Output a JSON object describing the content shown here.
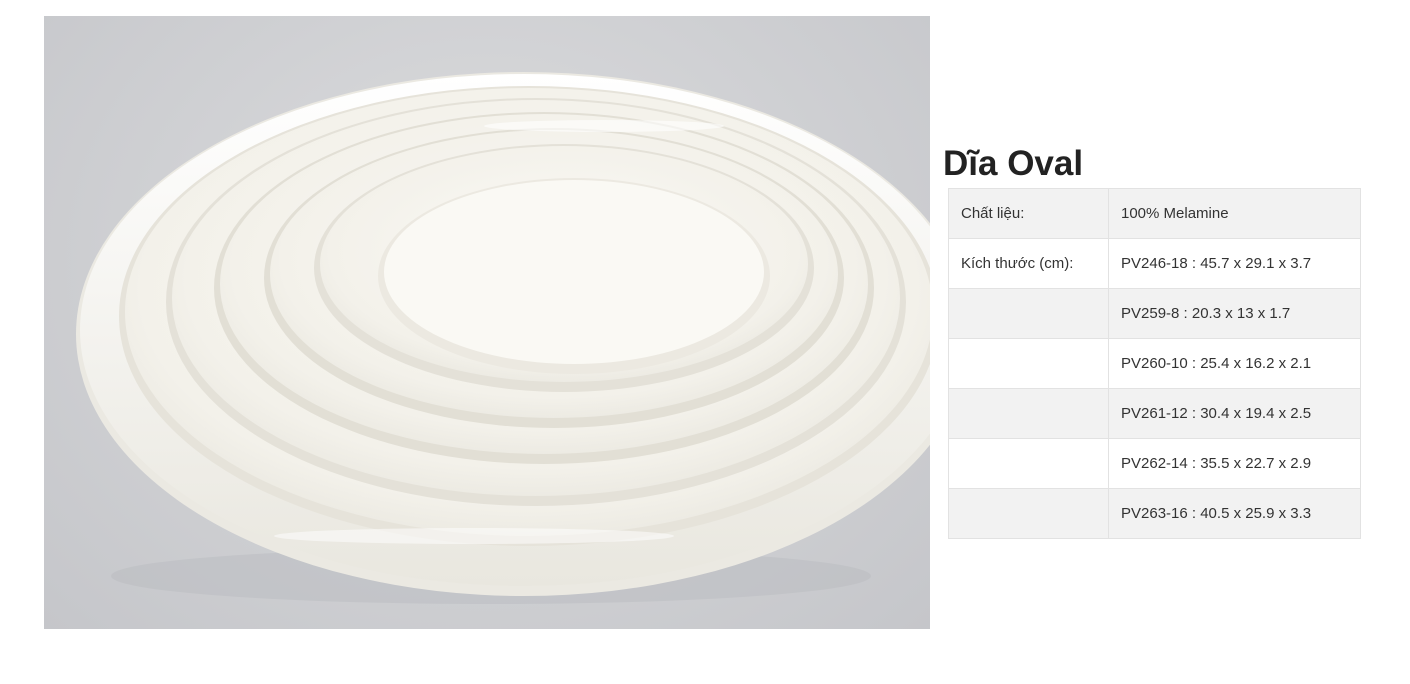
{
  "product": {
    "title": "Dĩa Oval",
    "image_alt": "Stacked white oval melamine plates"
  },
  "specs": {
    "rows": [
      {
        "label": "Chất liệu:",
        "value": "100% Melamine"
      },
      {
        "label": "Kích thước (cm):",
        "value": "PV246-18 : 45.7 x 29.1 x 3.7"
      },
      {
        "label": "",
        "value": "PV259-8 : 20.3 x 13 x 1.7"
      },
      {
        "label": "",
        "value": "PV260-10 : 25.4 x 16.2 x 2.1"
      },
      {
        "label": "",
        "value": "PV261-12 : 30.4 x 19.4 x 2.5"
      },
      {
        "label": "",
        "value": "PV262-14 : 35.5 x 22.7 x 2.9"
      },
      {
        "label": "",
        "value": "PV263-16 : 40.5 x 25.9 x 3.3"
      }
    ]
  },
  "colors": {
    "title": "#222222",
    "table_text": "#333333",
    "table_border": "#e2e2e2",
    "table_stripe": "#f2f2f2",
    "plate": "#f7f6f1",
    "photo_background": "#cfd0d3"
  }
}
